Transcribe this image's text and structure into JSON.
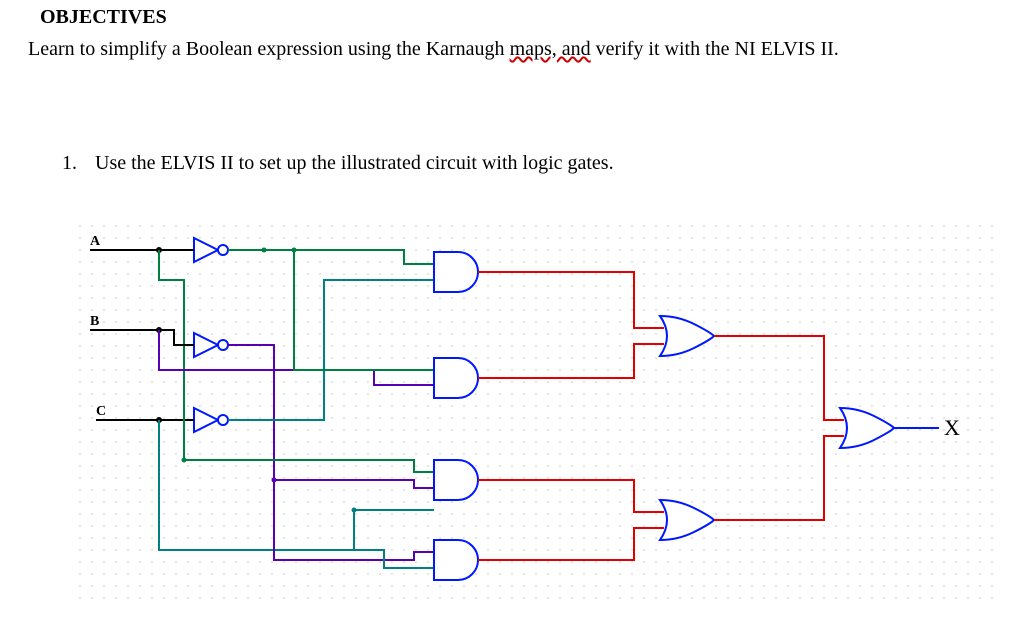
{
  "heading": "OBJECTIVES",
  "body_pre": "Learn to simplify a Boolean expression using the Karnaugh ",
  "body_spell": "maps, and",
  "body_post": " verify it with the NI ELVIS II.",
  "step_num": "1.",
  "step_text": "Use the ELVIS II to set up the illustrated circuit with logic gates.",
  "inputs": {
    "a": "A",
    "b": "B",
    "c": "C"
  },
  "output": "X",
  "gates": {
    "inverters": [
      "not-A",
      "not-B",
      "not-C"
    ],
    "and": [
      "AND1",
      "AND2",
      "AND3",
      "AND4"
    ],
    "or": [
      "OR1",
      "OR2",
      "OR-final"
    ]
  },
  "wire_colors": {
    "a": "green",
    "not_a": "green",
    "b": "purple",
    "not_b": "purple",
    "c": "teal",
    "not_c": "teal",
    "and_out": "red",
    "or_out": "red",
    "final": "blue"
  }
}
